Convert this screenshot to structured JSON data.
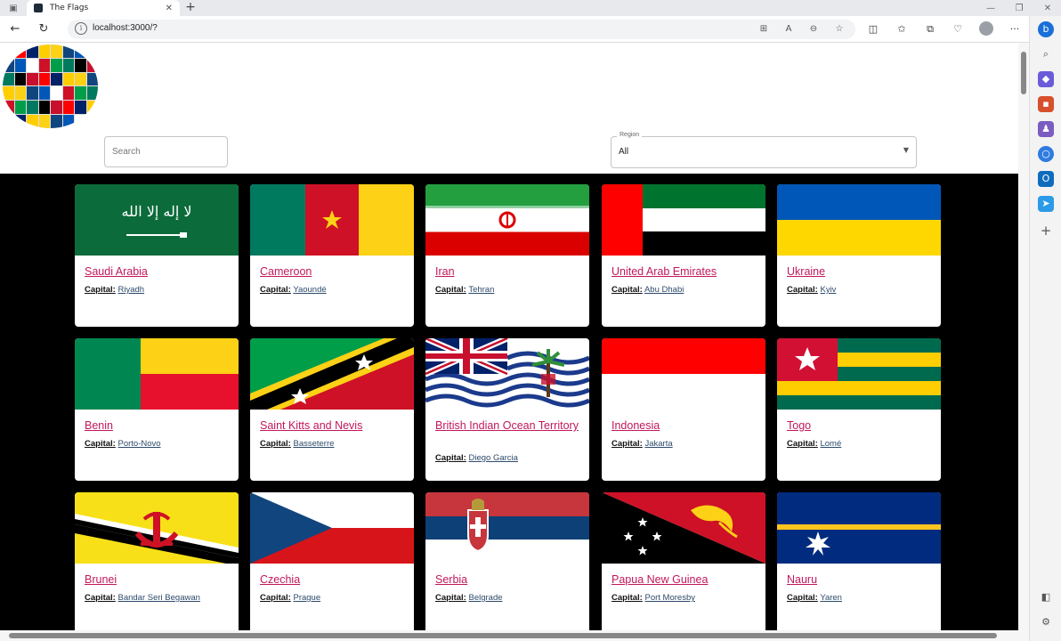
{
  "browser": {
    "tab_title": "The Flags",
    "url": "localhost:3000/?"
  },
  "search": {
    "placeholder": "Search"
  },
  "region": {
    "label": "Region",
    "value": "All"
  },
  "capital_label": "Capital:",
  "countries": [
    {
      "name": "Saudi Arabia",
      "capital": "Riyadh"
    },
    {
      "name": "Cameroon",
      "capital": "Yaoundé"
    },
    {
      "name": "Iran",
      "capital": "Tehran"
    },
    {
      "name": "United Arab Emirates",
      "capital": "Abu Dhabi"
    },
    {
      "name": "Ukraine",
      "capital": "Kyiv"
    },
    {
      "name": "Benin",
      "capital": "Porto-Novo"
    },
    {
      "name": "Saint Kitts and Nevis",
      "capital": "Basseterre"
    },
    {
      "name": "British Indian Ocean Territory",
      "capital": "Diego Garcia"
    },
    {
      "name": "Indonesia",
      "capital": "Jakarta"
    },
    {
      "name": "Togo",
      "capital": "Lomé"
    },
    {
      "name": "Brunei",
      "capital": "Bandar Seri Begawan"
    },
    {
      "name": "Czechia",
      "capital": "Prague"
    },
    {
      "name": "Serbia",
      "capital": "Belgrade"
    },
    {
      "name": "Papua New Guinea",
      "capital": "Port Moresby"
    },
    {
      "name": "Nauru",
      "capital": "Yaren"
    }
  ]
}
